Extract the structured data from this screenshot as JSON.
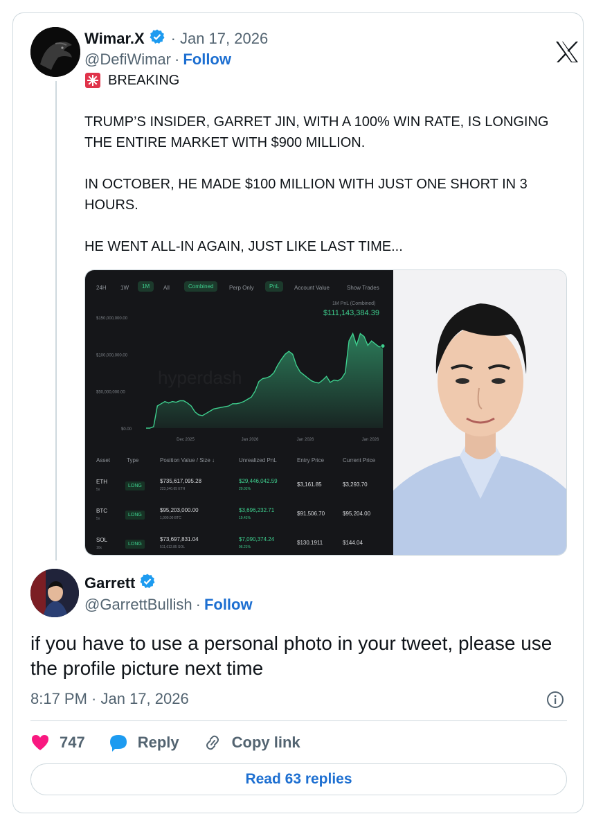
{
  "original_tweet": {
    "display_name": "Wimar.X",
    "date": "Jan 17, 2026",
    "handle": "@DefiWimar",
    "follow_label": "Follow",
    "text_header": "BREAKING",
    "text_p1": "TRUMP’S INSIDER, GARRET JIN, WITH A 100% WIN RATE, IS LONGING THE ENTIRE MARKET WITH $900 MILLION.",
    "text_p2": "IN OCTOBER, HE MADE $100 MILLION WITH JUST ONE SHORT IN 3 HOURS.",
    "text_p3": "HE WENT ALL-IN AGAIN, JUST LIKE LAST TIME..."
  },
  "dashboard": {
    "tabs": [
      "24H",
      "1W",
      "1M",
      "All",
      "Combined",
      "Perp Only",
      "PnL",
      "Account Value",
      "Show Trades"
    ],
    "pnl_label": "1M PnL (Combined)",
    "pnl_value": "$111,143,384.39",
    "watermark": "hyperdash",
    "columns": [
      "Asset",
      "Type",
      "Position Value / Size ↓",
      "Unrealized PnL",
      "Entry Price",
      "Current Price"
    ],
    "positions": [
      {
        "asset": "ETH",
        "lev": "5x",
        "type": "LONG",
        "value": "$735,617,095.28",
        "size": "223,340.65 ETH",
        "pnl": "$29,446,042.59",
        "pnl_pct": "20.01%",
        "entry": "$3,161.85",
        "current": "$3,293.70"
      },
      {
        "asset": "BTC",
        "lev": "5x",
        "type": "LONG",
        "value": "$95,203,000.00",
        "size": "1,000.00 BTC",
        "pnl": "$3,696,232.71",
        "pnl_pct": "19.41%",
        "entry": "$91,506.70",
        "current": "$95,204.00"
      },
      {
        "asset": "SOL",
        "lev": "10x",
        "type": "LONG",
        "value": "$73,697,831.04",
        "size": "511,612.85 SOL",
        "pnl": "$7,090,374.24",
        "pnl_pct": "96.21%",
        "entry": "$130.1911",
        "current": "$144.04"
      }
    ]
  },
  "chart_data": {
    "type": "area",
    "x_ticks": [
      "Dec 2025",
      "Jan 2026",
      "Jan 2026",
      "Jan 2026"
    ],
    "y_ticks": [
      "$0.00",
      "$50,000,000.00",
      "$100,000,000.00",
      "$150,000,000.00"
    ],
    "ylim": [
      0,
      150000000
    ],
    "color": "#3ecf8e",
    "series": [
      {
        "values": [
          0,
          0,
          2000000,
          30000000,
          33000000,
          36000000,
          34000000,
          36000000,
          35000000,
          37000000,
          37000000,
          34000000,
          30000000,
          22000000,
          18000000,
          17000000,
          20000000,
          23000000,
          26000000,
          27000000,
          28000000,
          29000000,
          30000000,
          33000000,
          33000000,
          34000000,
          36000000,
          39000000,
          42000000,
          50000000,
          63000000,
          67000000,
          68000000,
          70000000,
          75000000,
          85000000,
          93000000,
          100000000,
          104000000,
          100000000,
          85000000,
          76000000,
          72000000,
          68000000,
          64000000,
          62000000,
          61000000,
          65000000,
          70000000,
          62000000,
          65000000,
          64000000,
          67000000,
          75000000,
          118000000,
          128000000,
          112000000,
          128000000,
          124000000,
          112000000,
          118000000,
          114000000,
          110000000,
          111143384
        ]
      }
    ],
    "grid": false
  },
  "reply_tweet": {
    "display_name": "Garrett",
    "handle": "@GarrettBullish",
    "follow_label": "Follow",
    "text": "if you have to use a personal photo in your tweet, please use the profile picture next time",
    "timestamp": "8:17 PM · Jan 17, 2026",
    "likes": "747",
    "reply_label": "Reply",
    "copy_label": "Copy link",
    "read_replies": "Read 63 replies"
  },
  "colors": {
    "accent": "#1d6fd1",
    "like": "#f91880",
    "reply_icon": "#1d9bf0",
    "verified": "#1d9bf0"
  }
}
